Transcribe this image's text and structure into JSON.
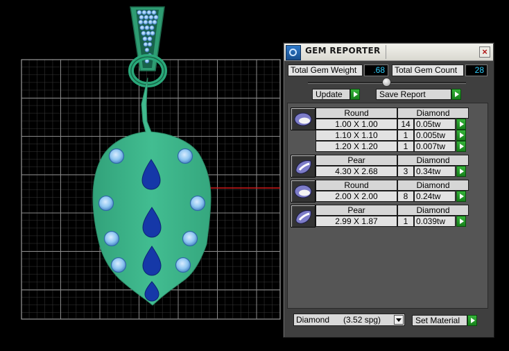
{
  "viewport": {
    "colors": {
      "background": "#000000",
      "grid": "#4a4a4a",
      "body": "#3cb489",
      "stone_blue": "#8ec6f1",
      "stone_sapphire": "#1538a8",
      "axis_red": "#d21a1a"
    }
  },
  "panel": {
    "title": "GEM REPORTER",
    "app_icon": "gem-reporter-icon",
    "close_icon": "close-icon",
    "close_glyph": "×",
    "total_weight_label": "Total Gem Weight",
    "total_weight_value": ".68",
    "total_count_label": "Total Gem Count",
    "total_count_value": "28",
    "update_label": "Update",
    "save_report_label": "Save Report",
    "gems": [
      {
        "shape": "Round",
        "material": "Diamond",
        "icon": "round-gem-icon",
        "rows": [
          {
            "size": "1.00 X 1.00",
            "count": "14",
            "weight": "0.05tw"
          },
          {
            "size": "1.10 X 1.10",
            "count": "1",
            "weight": "0.005tw"
          },
          {
            "size": "1.20 X 1.20",
            "count": "1",
            "weight": "0.007tw"
          }
        ]
      },
      {
        "shape": "Pear",
        "material": "Diamond",
        "icon": "pear-gem-icon",
        "rows": [
          {
            "size": "4.30 X 2.68",
            "count": "3",
            "weight": "0.34tw"
          }
        ]
      },
      {
        "shape": "Round",
        "material": "Diamond",
        "icon": "round-gem-icon",
        "rows": [
          {
            "size": "2.00 X 2.00",
            "count": "8",
            "weight": "0.24tw"
          }
        ]
      },
      {
        "shape": "Pear",
        "material": "Diamond",
        "icon": "pear-gem-icon",
        "rows": [
          {
            "size": "2.99 X 1.87",
            "count": "1",
            "weight": "0.039tw"
          }
        ]
      }
    ],
    "material_select": "Diamond      (3.52 spg)",
    "set_material_label": "Set Material",
    "accent_green": "#22a128"
  }
}
